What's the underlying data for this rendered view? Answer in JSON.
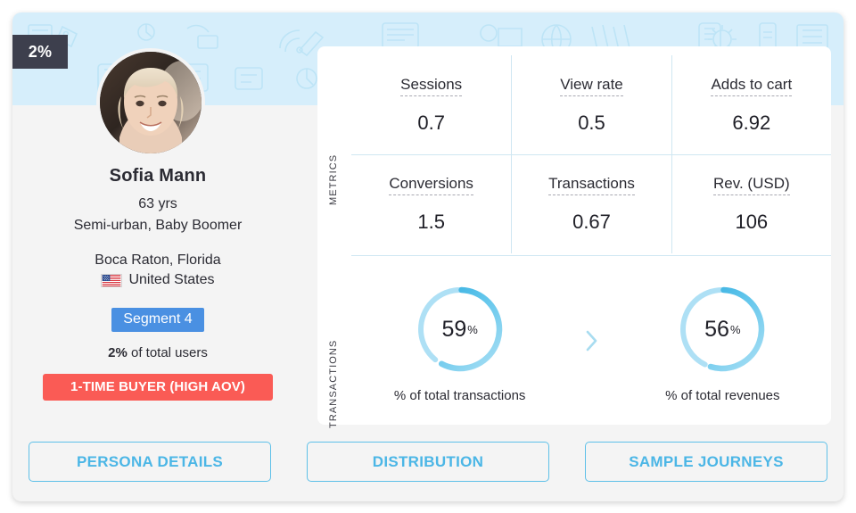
{
  "badge": {
    "percent": "2%"
  },
  "profile": {
    "name": "Sofia Mann",
    "age": "63 yrs",
    "segment_desc": "Semi-urban, Baby Boomer",
    "city": "Boca Raton, Florida",
    "country": "United States",
    "flag_icon": "us-flag-icon",
    "segment_badge": "Segment 4",
    "total_users_value": "2%",
    "total_users_suffix": " of total users",
    "buyer_tag": "1-TIME BUYER (HIGH AOV)",
    "avatar_icon": "avatar-photo"
  },
  "panel": {
    "metrics_label": "METRICS",
    "transactions_label": "TRANSACTIONS",
    "metrics": [
      {
        "label": "Sessions",
        "value": "0.7"
      },
      {
        "label": "View rate",
        "value": "0.5"
      },
      {
        "label": "Adds to cart",
        "value": "6.92"
      },
      {
        "label": "Conversions",
        "value": "1.5"
      },
      {
        "label": "Transactions",
        "value": "0.67"
      },
      {
        "label": "Rev. (USD)",
        "value": "106"
      }
    ],
    "arrow_icon": "chevron-right-icon",
    "donuts": [
      {
        "value": "59",
        "unit": "%",
        "caption": "% of total transactions"
      },
      {
        "value": "56",
        "unit": "%",
        "caption": "% of total revenues"
      }
    ]
  },
  "buttons": [
    {
      "label": "PERSONA DETAILS"
    },
    {
      "label": "DISTRIBUTION"
    },
    {
      "label": "SAMPLE JOURNEYS"
    }
  ],
  "chart_data": {
    "type": "pie",
    "title": "TRANSACTIONS",
    "series": [
      {
        "name": "% of total transactions",
        "value": 59,
        "max": 100
      },
      {
        "name": "% of total revenues",
        "value": 56,
        "max": 100
      }
    ],
    "colors": {
      "arc_light": "#8fd6f2",
      "arc_dark": "#34b0e0",
      "track": "#aee0f5"
    }
  },
  "colors": {
    "banner": "#d6eefb",
    "accent": "#4bb6e6",
    "segment": "#4a90e2",
    "tag": "#fa5b55",
    "badge_dark": "#3d3f4d",
    "card_bg": "#f4f4f4"
  }
}
